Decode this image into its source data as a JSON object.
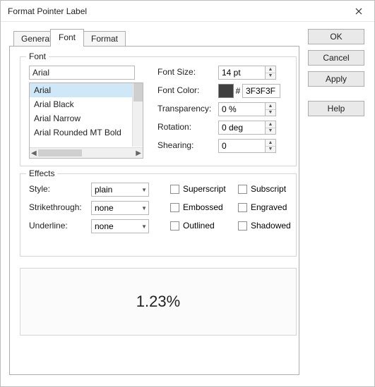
{
  "window": {
    "title": "Format Pointer Label"
  },
  "buttons": {
    "ok": "OK",
    "cancel": "Cancel",
    "apply": "Apply",
    "help": "Help"
  },
  "tabs": {
    "general": "General",
    "font": "Font",
    "format": "Format"
  },
  "fontGroup": {
    "legend": "Font",
    "fontName": "Arial",
    "list": [
      "Arial",
      "Arial Black",
      "Arial Narrow",
      "Arial Rounded MT Bold"
    ],
    "labels": {
      "fontSize": "Font Size:",
      "fontColor": "Font Color:",
      "transparency": "Transparency:",
      "rotation": "Rotation:",
      "shearing": "Shearing:"
    },
    "fontSize": "14 pt",
    "fontColorHash": "#",
    "fontColorHex": "3F3F3F",
    "transparency": "0 %",
    "rotation": "0 deg",
    "shearing": "0"
  },
  "effects": {
    "legend": "Effects",
    "labels": {
      "style": "Style:",
      "strike": "Strikethrough:",
      "underline": "Underline:"
    },
    "style": "plain",
    "strike": "none",
    "underline": "none",
    "checks": {
      "superscript": "Superscript",
      "subscript": "Subscript",
      "embossed": "Embossed",
      "engraved": "Engraved",
      "outlined": "Outlined",
      "shadowed": "Shadowed"
    }
  },
  "preview": "1.23%"
}
